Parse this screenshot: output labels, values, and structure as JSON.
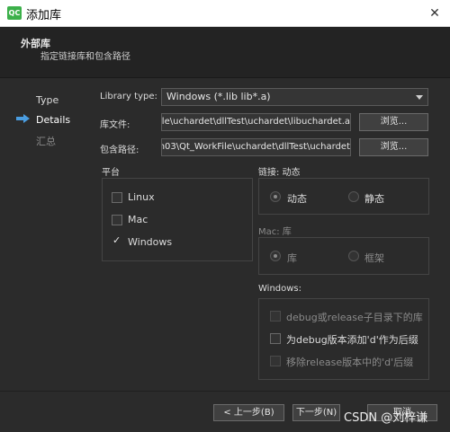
{
  "window": {
    "title": "添加库",
    "logo_text": "QC",
    "close_glyph": "✕"
  },
  "header": {
    "title": "外部库",
    "subtitle": "指定链接库和包含路径"
  },
  "steps": [
    {
      "label": "Type",
      "state": "done"
    },
    {
      "label": "Details",
      "state": "current"
    },
    {
      "label": "汇总",
      "state": "pending"
    }
  ],
  "form": {
    "library_type_label": "Library type:",
    "library_type_value": "Windows (*.lib lib*.a)",
    "lib_file_label": "库文件:",
    "lib_file_value": "ile\\uchardet\\dllTest\\uchardet\\libuchardet.a",
    "include_path_label": "包含路径:",
    "include_path_value": "n03\\Qt_WorkFile\\uchardet\\dllTest\\uchardet",
    "browse_label": "浏览..."
  },
  "platform": {
    "title": "平台",
    "items": [
      {
        "label": "Linux",
        "checked": false
      },
      {
        "label": "Mac",
        "checked": false
      },
      {
        "label": "Windows",
        "checked": true
      }
    ]
  },
  "linkage": {
    "title": "链接: 动态",
    "option_dynamic": "动态",
    "option_static": "静态"
  },
  "mac": {
    "title": "Mac: 库",
    "option_library": "库",
    "option_framework": "框架"
  },
  "windows": {
    "title": "Windows:",
    "options": [
      {
        "label": "debug或release子目录下的库",
        "checked": false,
        "enabled": false
      },
      {
        "label": "为debug版本添加'd'作为后缀",
        "checked": false,
        "enabled": true
      },
      {
        "label": "移除release版本中的'd'后缀",
        "checked": false,
        "enabled": false
      }
    ]
  },
  "footer": {
    "back_label": "< 上一步(B)",
    "next_label": "下一步(N)",
    "cancel_label": "取消",
    "watermark": "CSDN @刘梓谦"
  }
}
